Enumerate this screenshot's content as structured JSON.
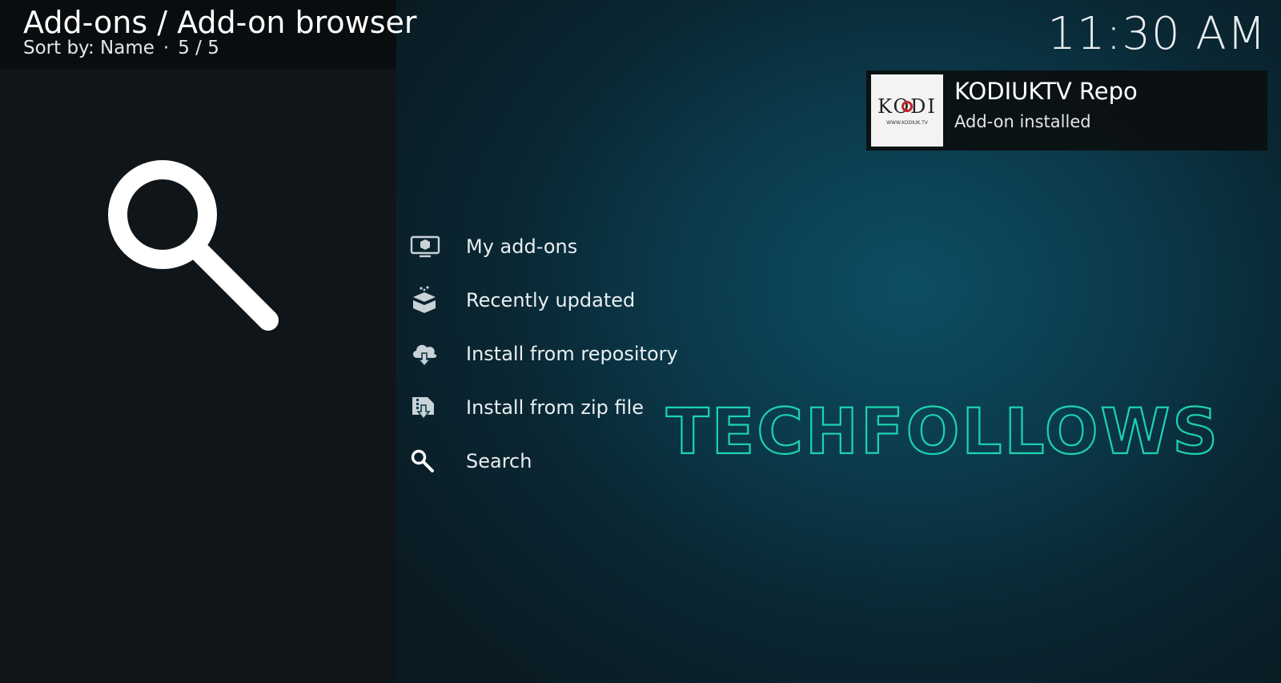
{
  "header": {
    "title": "Add-ons / Add-on browser",
    "sort_label": "Sort by: Name",
    "separator": "·",
    "count": "5 / 5"
  },
  "clock": "11:30 AM",
  "notification": {
    "title": "KODIUKTV Repo",
    "message": "Add-on installed",
    "thumb_word": "KODI",
    "thumb_url": "WWW.KODIUK.TV"
  },
  "menu": {
    "items": [
      {
        "label": "My add-ons",
        "icon": "monitor-box-icon"
      },
      {
        "label": "Recently updated",
        "icon": "open-box-icon"
      },
      {
        "label": "Install from repository",
        "icon": "cloud-download-icon"
      },
      {
        "label": "Install from zip file",
        "icon": "zip-download-icon"
      },
      {
        "label": "Search",
        "icon": "search-icon"
      }
    ]
  },
  "watermark": "TECHFOLLOWS",
  "colors": {
    "background_accent": "#0e4d63",
    "left_panel": "#0f1518",
    "watermark": "#1dd3b0",
    "text": "#ffffff"
  }
}
